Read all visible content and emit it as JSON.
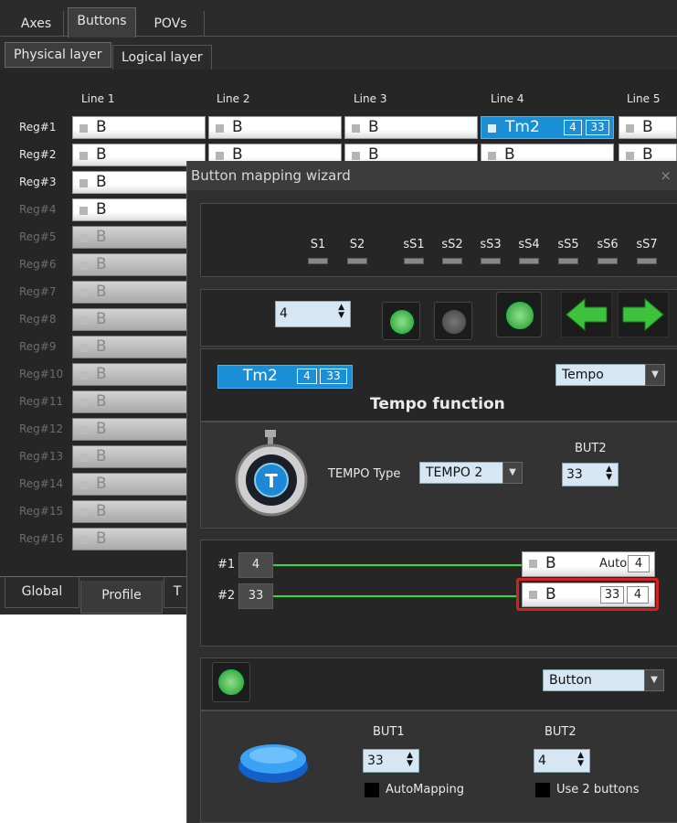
{
  "top_tabs": [
    "Axes",
    "Buttons",
    "POVs"
  ],
  "sub_tabs": [
    "Physical layer",
    "Logical layer"
  ],
  "grid": {
    "lines": [
      "Line 1",
      "Line 2",
      "Line 3",
      "Line 4",
      "Line 5"
    ],
    "regs": [
      "Reg#1",
      "Reg#2",
      "Reg#3",
      "Reg#4",
      "Reg#5",
      "Reg#6",
      "Reg#7",
      "Reg#8",
      "Reg#9",
      "Reg#10",
      "Reg#11",
      "Reg#12",
      "Reg#13",
      "Reg#14",
      "Reg#15",
      "Reg#16"
    ],
    "cell_label": "B",
    "selected": {
      "label": "Tm2",
      "box1": "4",
      "box2": "33"
    }
  },
  "bottom_tabs": [
    "Global",
    "Profile",
    "T"
  ],
  "wizard": {
    "title": "Button mapping wizard",
    "close": "×",
    "switches": [
      "S1",
      "S2",
      "sS1",
      "sS2",
      "sS3",
      "sS4",
      "sS5",
      "sS6",
      "sS7"
    ],
    "spin_value": "4",
    "function_button": {
      "label": "Tm2",
      "box1": "4",
      "box2": "33"
    },
    "function_dropdown": "Tempo",
    "function_title": "Tempo function",
    "tempo_type_label": "TEMPO Type",
    "tempo_type_value": "TEMPO 2",
    "but2_label": "BUT2",
    "but2_value": "33",
    "mapping": [
      {
        "label": "#1",
        "value": "4",
        "btn": "B",
        "tag": "Auto",
        "box": "4"
      },
      {
        "label": "#2",
        "value": "33",
        "btn": "B",
        "box1": "33",
        "box2": "4"
      }
    ],
    "bottom_dropdown": "Button",
    "bottom_but1_label": "BUT1",
    "bottom_but1_value": "33",
    "bottom_but2_label": "BUT2",
    "bottom_but2_value": "4",
    "automapping_label": "AutoMapping",
    "use2_label": "Use 2 buttons"
  },
  "colors": {
    "accent": "#1a8fd6",
    "green": "#2ee02e",
    "highlight": "#d42020"
  }
}
